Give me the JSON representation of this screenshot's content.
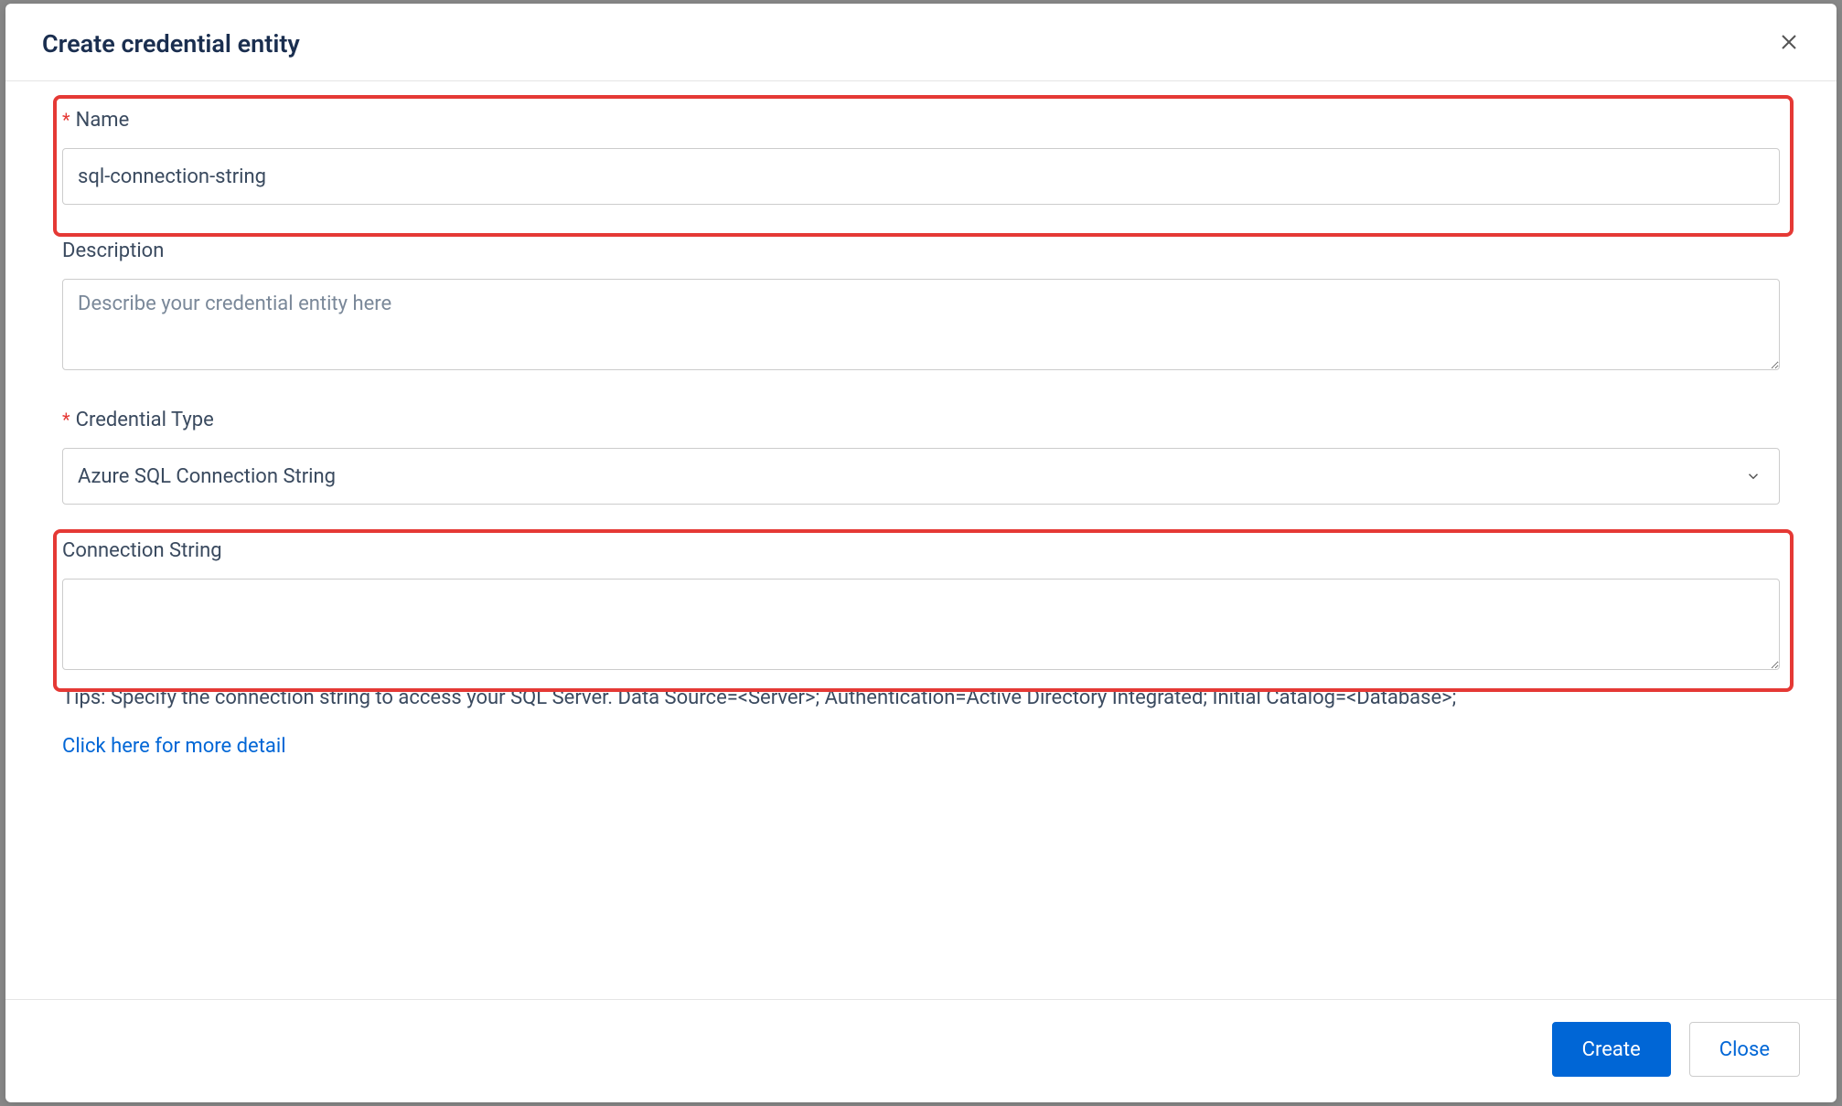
{
  "modal": {
    "title": "Create credential entity",
    "name": {
      "label": "Name",
      "value": "sql-connection-string"
    },
    "description": {
      "label": "Description",
      "placeholder": "Describe your credential entity here",
      "value": ""
    },
    "credential_type": {
      "label": "Credential Type",
      "selected": "Azure SQL Connection String"
    },
    "connection_string": {
      "label": "Connection String",
      "value": "",
      "tips": "Tips: Specify the connection string to access your SQL Server. Data Source=<Server>; Authentication=Active Directory Integrated; Initial Catalog=<Database>;",
      "link": "Click here for more detail"
    },
    "buttons": {
      "create": "Create",
      "close": "Close"
    }
  }
}
